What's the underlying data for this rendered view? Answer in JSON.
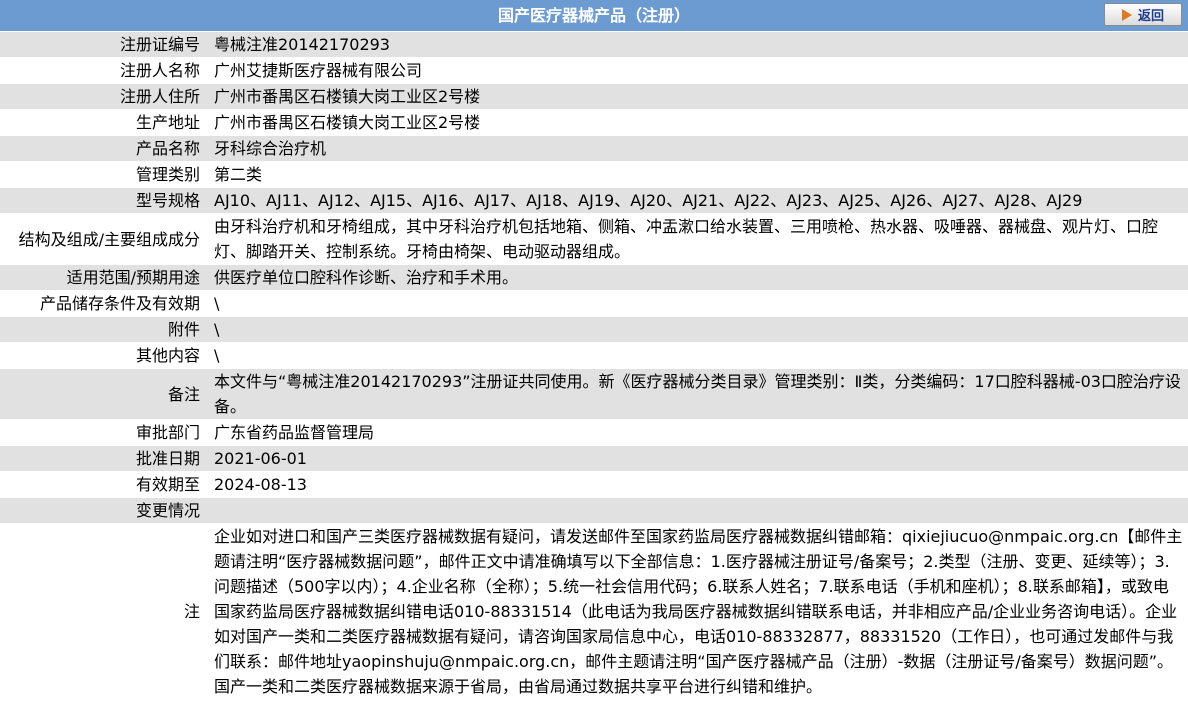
{
  "header": {
    "title": "国产医疗器械产品（注册）",
    "back_label": "返回",
    "back_icon": "arrow-right-icon"
  },
  "rows": [
    {
      "label": "注册证编号",
      "value": "粤械注准20142170293"
    },
    {
      "label": "注册人名称",
      "value": "广州艾捷斯医疗器械有限公司"
    },
    {
      "label": "注册人住所",
      "value": "广州市番禺区石楼镇大岗工业区2号楼"
    },
    {
      "label": "生产地址",
      "value": "广州市番禺区石楼镇大岗工业区2号楼"
    },
    {
      "label": "产品名称",
      "value": "牙科综合治疗机"
    },
    {
      "label": "管理类别",
      "value": "第二类"
    },
    {
      "label": "型号规格",
      "value": "AJ10、AJ11、AJ12、AJ15、AJ16、AJ17、AJ18、AJ19、AJ20、AJ21、AJ22、AJ23、AJ25、AJ26、AJ27、AJ28、AJ29"
    },
    {
      "label": "结构及组成/主要组成成分",
      "value": "由牙科治疗机和牙椅组成，其中牙科治疗机包括地箱、侧箱、冲盂漱口给水装置、三用喷枪、热水器、吸唾器、器械盘、观片灯、口腔灯、脚踏开关、控制系统。牙椅由椅架、电动驱动器组成。"
    },
    {
      "label": "适用范围/预期用途",
      "value": "供医疗单位口腔科作诊断、治疗和手术用。"
    },
    {
      "label": "产品储存条件及有效期",
      "value": "\\"
    },
    {
      "label": "附件",
      "value": "\\"
    },
    {
      "label": "其他内容",
      "value": "\\"
    },
    {
      "label": "备注",
      "value": "本文件与“粤械注准20142170293”注册证共同使用。新《医疗器械分类目录》管理类别：Ⅱ类，分类编码：17口腔科器械-03口腔治疗设备。"
    },
    {
      "label": "审批部门",
      "value": "广东省药品监督管理局"
    },
    {
      "label": "批准日期",
      "value": "2021-06-01"
    },
    {
      "label": "有效期至",
      "value": "2024-08-13"
    },
    {
      "label": "变更情况",
      "value": ""
    },
    {
      "label": "注",
      "value": "企业如对进口和国产三类医疗器械数据有疑问，请发送邮件至国家药监局医疗器械数据纠错邮箱：qixiejiucuo@nmpaic.org.cn【邮件主题请注明“医疗器械数据问题”，邮件正文中请准确填写以下全部信息：1.医疗器械注册证号/备案号；2.类型（注册、变更、延续等）；3.问题描述（500字以内）；4.企业名称（全称）；5.统一社会信用代码；6.联系人姓名；7.联系电话（手机和座机）；8.联系邮箱】，或致电国家药监局医疗器械数据纠错电话010-88331514（此电话为我局医疗器械数据纠错联系电话，并非相应产品/企业业务咨询电话）。企业如对国产一类和二类医疗器械数据有疑问，请咨询国家局信息中心，电话010-88332877，88331520（工作日），也可通过发邮件与我们联系：邮件地址yaopinshuju@nmpaic.org.cn，邮件主题请注明“国产医疗器械产品（注册）-数据（注册证号/备案号）数据问题”。国产一类和二类医疗器械数据来源于省局，由省局通过数据共享平台进行纠错和维护。"
    }
  ]
}
